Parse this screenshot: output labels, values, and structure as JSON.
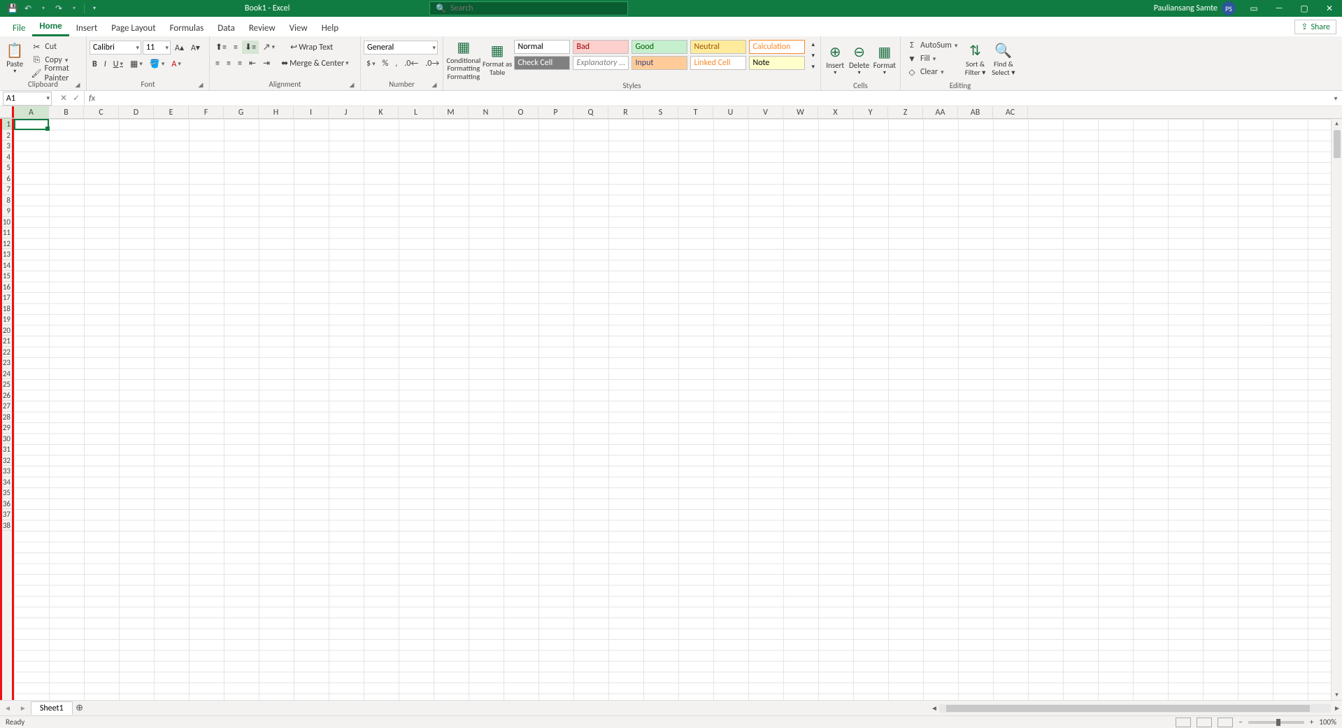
{
  "title": "Book1 - Excel",
  "search_placeholder": "Search",
  "user": {
    "name": "Pauliansang Samte",
    "initials": "PS"
  },
  "tabs": {
    "file": "File",
    "home": "Home",
    "insert": "Insert",
    "page_layout": "Page Layout",
    "formulas": "Formulas",
    "data": "Data",
    "review": "Review",
    "view": "View",
    "help": "Help"
  },
  "share": "Share",
  "clipboard": {
    "label": "Clipboard",
    "paste": "Paste",
    "cut": "Cut",
    "copy": "Copy",
    "format_painter": "Format Painter"
  },
  "font": {
    "label": "Font",
    "name": "Calibri",
    "size": "11"
  },
  "alignment": {
    "label": "Alignment",
    "wrap": "Wrap Text",
    "merge": "Merge & Center"
  },
  "number": {
    "label": "Number",
    "format": "General"
  },
  "styles": {
    "label": "Styles",
    "cond": "Conditional Formatting",
    "cond2": "Formatting",
    "fat": "Format as Table",
    "fat2": "Table",
    "normal": "Normal",
    "bad": "Bad",
    "good": "Good",
    "neutral": "Neutral",
    "calc": "Calculation",
    "check": "Check Cell",
    "expl": "Explanatory ...",
    "input": "Input",
    "linked": "Linked Cell",
    "note": "Note"
  },
  "cells": {
    "label": "Cells",
    "insert": "Insert",
    "delete": "Delete",
    "format": "Format"
  },
  "editing": {
    "label": "Editing",
    "autosum": "AutoSum",
    "fill": "Fill",
    "clear": "Clear",
    "sort": "Sort & Filter",
    "find": "Find & Select"
  },
  "namebox": "A1",
  "columns": [
    "A",
    "B",
    "C",
    "D",
    "E",
    "F",
    "G",
    "H",
    "I",
    "J",
    "K",
    "L",
    "M",
    "N",
    "O",
    "P",
    "Q",
    "R",
    "S",
    "T",
    "U",
    "V",
    "W",
    "X",
    "Y",
    "Z",
    "AA",
    "AB",
    "AC"
  ],
  "rows": 38,
  "sheet": "Sheet1",
  "status": "Ready",
  "zoom": "100%"
}
